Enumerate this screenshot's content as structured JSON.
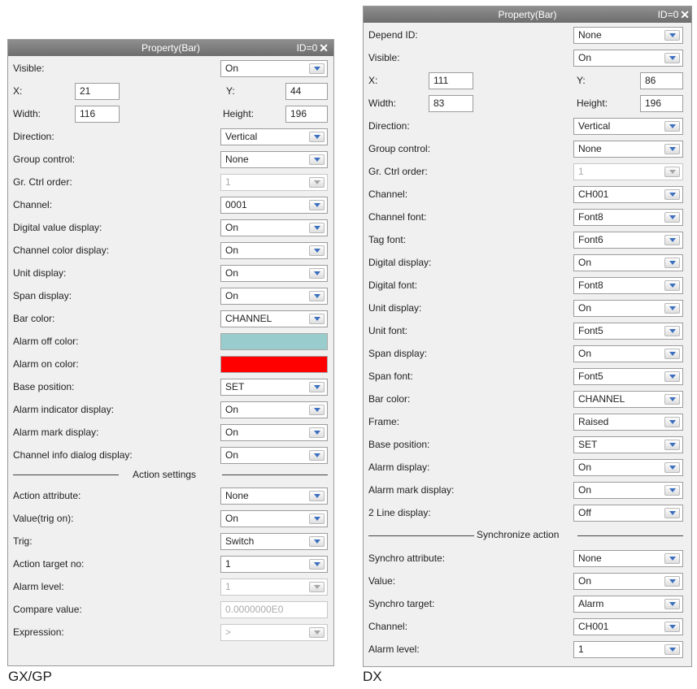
{
  "gx": {
    "title": "Property(Bar)",
    "id_label": "ID=0",
    "caption": "GX/GP",
    "visible": {
      "label": "Visible:",
      "value": "On"
    },
    "x": {
      "label": "X:",
      "value": "21"
    },
    "y": {
      "label": "Y:",
      "value": "44"
    },
    "width": {
      "label": "Width:",
      "value": "116"
    },
    "height": {
      "label": "Height:",
      "value": "196"
    },
    "direction": {
      "label": "Direction:",
      "value": "Vertical"
    },
    "group_control": {
      "label": "Group control:",
      "value": "None"
    },
    "gr_ctrl_order": {
      "label": "Gr. Ctrl order:",
      "value": "1"
    },
    "channel": {
      "label": "Channel:",
      "value": "0001"
    },
    "digital_value_display": {
      "label": "Digital value display:",
      "value": "On"
    },
    "channel_color_display": {
      "label": "Channel color display:",
      "value": "On"
    },
    "unit_display": {
      "label": "Unit display:",
      "value": "On"
    },
    "span_display": {
      "label": "Span display:",
      "value": "On"
    },
    "bar_color": {
      "label": "Bar color:",
      "value": "CHANNEL"
    },
    "alarm_off_color": {
      "label": "Alarm off color:",
      "color": "#99cccc"
    },
    "alarm_on_color": {
      "label": "Alarm on color:",
      "color": "#ff0000"
    },
    "base_position": {
      "label": "Base position:",
      "value": "SET"
    },
    "alarm_indicator_display": {
      "label": "Alarm indicator display:",
      "value": "On"
    },
    "alarm_mark_display": {
      "label": "Alarm mark display:",
      "value": "On"
    },
    "channel_info_dialog_display": {
      "label": "Channel info dialog display:",
      "value": "On"
    },
    "section": "Action settings",
    "action_attribute": {
      "label": "Action attribute:",
      "value": "None"
    },
    "value_trig_on": {
      "label": "Value(trig on):",
      "value": "On"
    },
    "trig": {
      "label": "Trig:",
      "value": "Switch"
    },
    "action_target_no": {
      "label": "Action target no:",
      "value": "1"
    },
    "alarm_level": {
      "label": "Alarm level:",
      "value": "1"
    },
    "compare_value": {
      "label": "Compare value:",
      "value": "0.0000000E0"
    },
    "expression": {
      "label": "Expression:",
      "value": ">"
    }
  },
  "dx": {
    "title": "Property(Bar)",
    "id_label": "ID=0",
    "caption": "DX",
    "depend_id": {
      "label": "Depend ID:",
      "value": "None"
    },
    "visible": {
      "label": "Visible:",
      "value": "On"
    },
    "x": {
      "label": "X:",
      "value": "111"
    },
    "y": {
      "label": "Y:",
      "value": "86"
    },
    "width": {
      "label": "Width:",
      "value": "83"
    },
    "height": {
      "label": "Height:",
      "value": "196"
    },
    "direction": {
      "label": "Direction:",
      "value": "Vertical"
    },
    "group_control": {
      "label": "Group control:",
      "value": "None"
    },
    "gr_ctrl_order": {
      "label": "Gr. Ctrl order:",
      "value": "1"
    },
    "channel": {
      "label": "Channel:",
      "value": "CH001"
    },
    "channel_font": {
      "label": "Channel font:",
      "value": "Font8"
    },
    "tag_font": {
      "label": "Tag font:",
      "value": "Font6"
    },
    "digital_display": {
      "label": "Digital display:",
      "value": "On"
    },
    "digital_font": {
      "label": "Digital font:",
      "value": "Font8"
    },
    "unit_display": {
      "label": "Unit display:",
      "value": "On"
    },
    "unit_font": {
      "label": "Unit font:",
      "value": "Font5"
    },
    "span_display": {
      "label": "Span display:",
      "value": "On"
    },
    "span_font": {
      "label": "Span font:",
      "value": "Font5"
    },
    "bar_color": {
      "label": "Bar color:",
      "value": "CHANNEL"
    },
    "frame": {
      "label": "Frame:",
      "value": "Raised"
    },
    "base_position": {
      "label": "Base position:",
      "value": "SET"
    },
    "alarm_display": {
      "label": "Alarm display:",
      "value": "On"
    },
    "alarm_mark_display": {
      "label": "Alarm mark display:",
      "value": "On"
    },
    "two_line_display": {
      "label": "2 Line display:",
      "value": "Off"
    },
    "section": "Synchronize action",
    "synchro_attribute": {
      "label": "Synchro attribute:",
      "value": "None"
    },
    "value": {
      "label": "Value:",
      "value": "On"
    },
    "synchro_target": {
      "label": "Synchro target:",
      "value": "Alarm"
    },
    "channel2": {
      "label": "Channel:",
      "value": "CH001"
    },
    "alarm_level": {
      "label": "Alarm level:",
      "value": "1"
    }
  }
}
